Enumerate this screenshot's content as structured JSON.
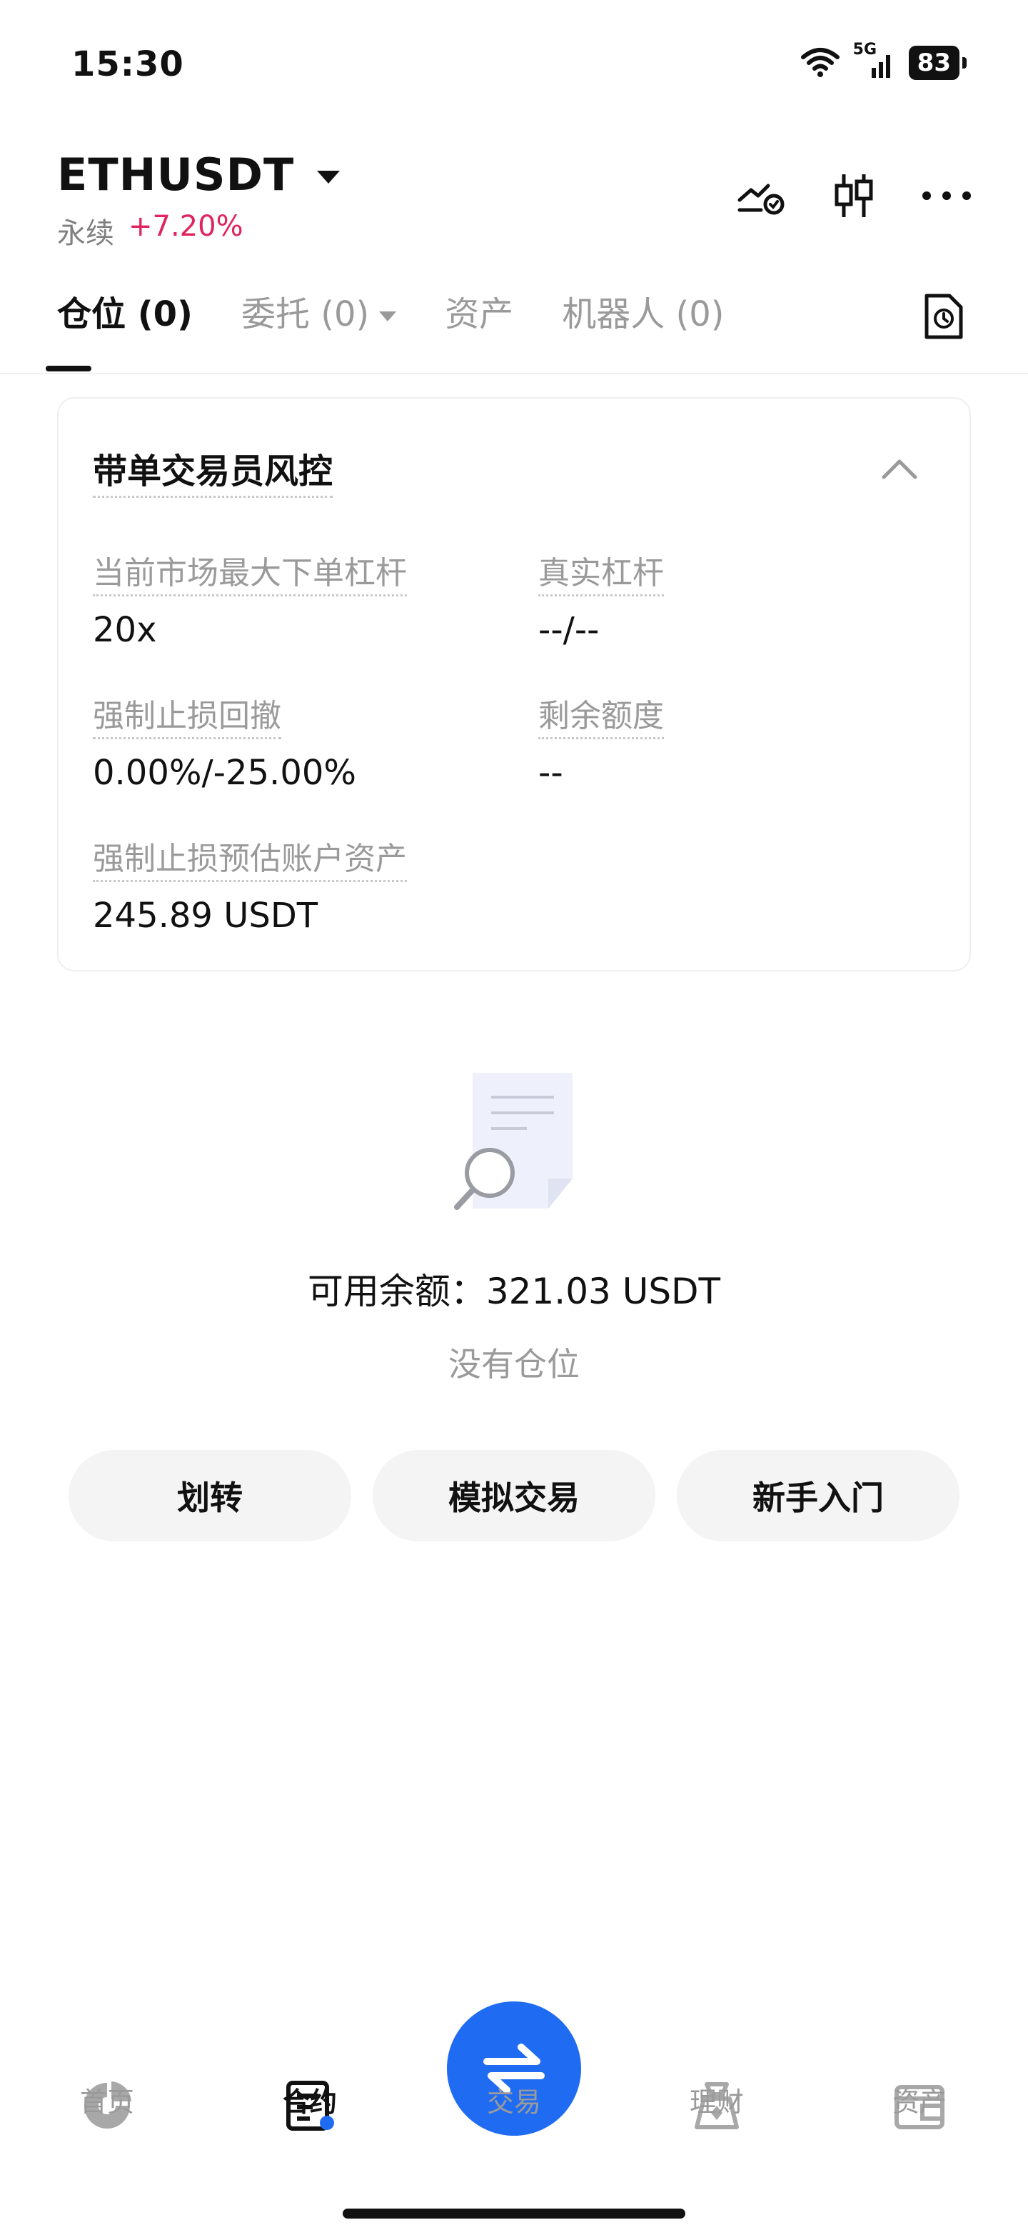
{
  "status_bar": {
    "time": "15:30",
    "network": "5G",
    "battery": "83"
  },
  "header": {
    "pair": "ETHUSDT",
    "contract_type": "永续",
    "change": "+7.20%",
    "icons": [
      "strategy-chart-icon",
      "candlestick-icon",
      "more-icon"
    ]
  },
  "tabs": [
    {
      "label": "仓位 (0)",
      "active": true
    },
    {
      "label": "委托 (0)",
      "has_dropdown": true
    },
    {
      "label": "资产"
    },
    {
      "label": "机器人 (0)"
    }
  ],
  "risk_card": {
    "title": "带单交易员风控",
    "fields": [
      {
        "label": "当前市场最大下单杠杆",
        "value": "20x"
      },
      {
        "label": "真实杠杆",
        "value": "--/--"
      },
      {
        "label": "强制止损回撤",
        "value": "0.00%/-25.00%"
      },
      {
        "label": "剩余额度",
        "value": "--"
      },
      {
        "label": "强制止损预估账户资产",
        "value": "245.89 USDT"
      }
    ]
  },
  "empty_state": {
    "balance_text": "可用余额：321.03 USDT",
    "message": "没有仓位"
  },
  "actions": [
    "划转",
    "模拟交易",
    "新手入门"
  ],
  "bottom_nav": [
    {
      "label": "首页",
      "icon": "home-icon"
    },
    {
      "label": "合约",
      "icon": "contract-icon",
      "active": true
    },
    {
      "label": "交易",
      "icon": "swap-icon"
    },
    {
      "label": "理财",
      "icon": "finance-icon"
    },
    {
      "label": "资产",
      "icon": "wallet-icon"
    }
  ],
  "colors": {
    "accent": "#1f6cf3",
    "positive_change": "#e0245e",
    "muted_text": "#9a9a9a"
  }
}
